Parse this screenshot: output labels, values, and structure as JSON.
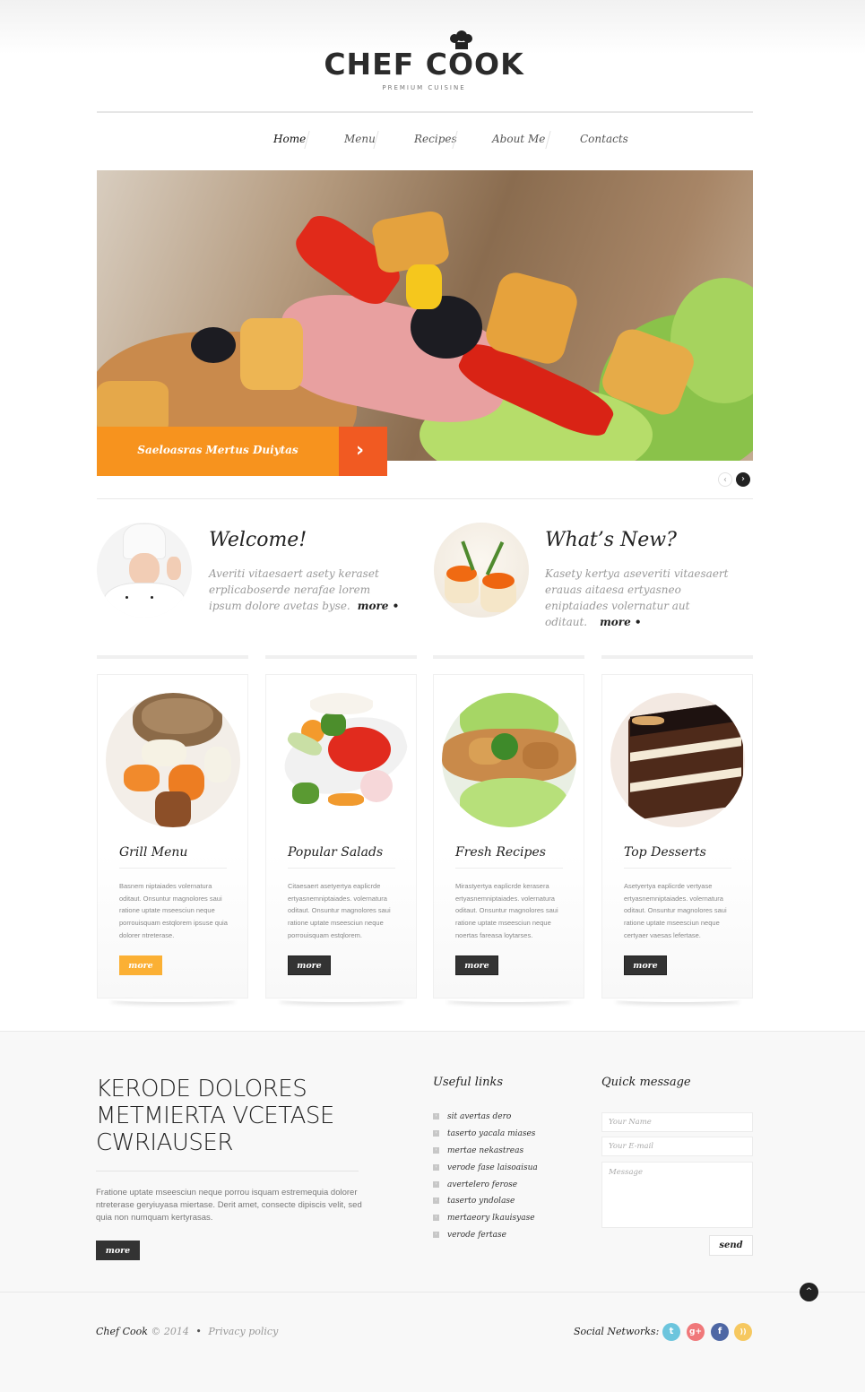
{
  "brand": {
    "name": "CHEF COOK",
    "tagline": "PREMIUM CUISINE"
  },
  "nav": {
    "items": [
      {
        "label": "Home",
        "active": true
      },
      {
        "label": "Menu",
        "active": false
      },
      {
        "label": "Recipes",
        "active": false
      },
      {
        "label": "About Me",
        "active": false
      },
      {
        "label": "Contacts",
        "active": false
      }
    ]
  },
  "slider": {
    "caption": "Saeloasras Mertus Duiytas",
    "next_icon": "›",
    "pager_prev_icon": "‹",
    "pager_next_icon": "›",
    "caption_color": "#f7931e",
    "arrow_color": "#f15a22"
  },
  "intro": [
    {
      "title": "Welcome!",
      "text": "Averiti vitaesaert asety keraset erplicaboserde nerafae lorem ipsum dolore avetas byse.",
      "more": "more •",
      "image": "chef-woman-photo"
    },
    {
      "title": "What’s New?",
      "text": "Kasety kertya aseveriti vitaesaert erauas aitaesa ertyasneo eniptaiades volernatur aut oditaut.",
      "more": "more •",
      "image": "caviar-tartlets-photo"
    }
  ],
  "cards": [
    {
      "title": "Grill Menu",
      "text": "Basnem niptaiades volernatura oditaut. Onsuntur magnolores saui ratione uptate mseesciun neque porrouisquam estqlorem ipsuse quia dolorer ntreterase.",
      "button": "more",
      "button_style": "yellow",
      "image": "grilled-chicken-photo"
    },
    {
      "title": "Popular Salads",
      "text": "Citaesaert asetyertya eaplicrde ertyasnemniptaiades. volernatura oditaut. Onsuntur magnolores saui ratione uptate mseesciun neque porrouisquam estqlorem.",
      "button": "more",
      "button_style": "dark",
      "image": "salad-bowl-photo"
    },
    {
      "title": "Fresh Recipes",
      "text": "Mirastyertya eaplicrde kerasera ertyasnemniptaiades. volernatura oditaut. Onsuntur magnolores saui ratione uptate mseesciun neque noertas fareasa loytarses.",
      "button": "more",
      "button_style": "dark",
      "image": "chicken-lettuce-photo"
    },
    {
      "title": "Top Desserts",
      "text": "Asetyertya eaplicrde vertyase ertyasnemniptaiades. volernatura oditaut. Onsuntur magnolores saui ratione uptate mseesciun neque certyaer vaesas lefertase.",
      "button": "more",
      "button_style": "dark",
      "image": "chocolate-cake-photo"
    }
  ],
  "footer": {
    "heading": "KERODE DOLORES METMIERTA VCETASE CWRIAUSER",
    "paragraph": "Fratione uptate mseesciun neque porrou isquam estremequia dolorer ntreterase geryiuyasa miertase. Derit amet, consecte dipiscis velit, sed quia non numquam kertyrasas.",
    "more": "more",
    "useful_links": {
      "title": "Useful links",
      "items": [
        "sit avertas dero",
        "taserto yacala miases",
        "mertae nekastreas",
        "verode fase laisoaisua",
        "avertelero ferose",
        "taserto yndolase",
        "mertaeory lkauisyase",
        "verode fertase"
      ]
    },
    "quick_message": {
      "title": "Quick message",
      "name_placeholder": "Your Name",
      "email_placeholder": "Your E-mail",
      "message_placeholder": "Message",
      "name_value": "",
      "email_value": "",
      "message_value": "",
      "send": "send"
    },
    "back_to_top_icon": "^",
    "copyright": {
      "brand": "Chef Cook",
      "year": "© 2014",
      "separator": "•",
      "privacy": "Privacy policy"
    },
    "social": {
      "label": "Social Networks:",
      "items": [
        {
          "name": "twitter",
          "glyph": "t",
          "color": "#6cc5dd"
        },
        {
          "name": "google-plus",
          "glyph": "g+",
          "color": "#f0787a"
        },
        {
          "name": "facebook",
          "glyph": "f",
          "color": "#4e67a4"
        },
        {
          "name": "rss",
          "glyph": "))",
          "color": "#f6c860"
        }
      ]
    }
  }
}
